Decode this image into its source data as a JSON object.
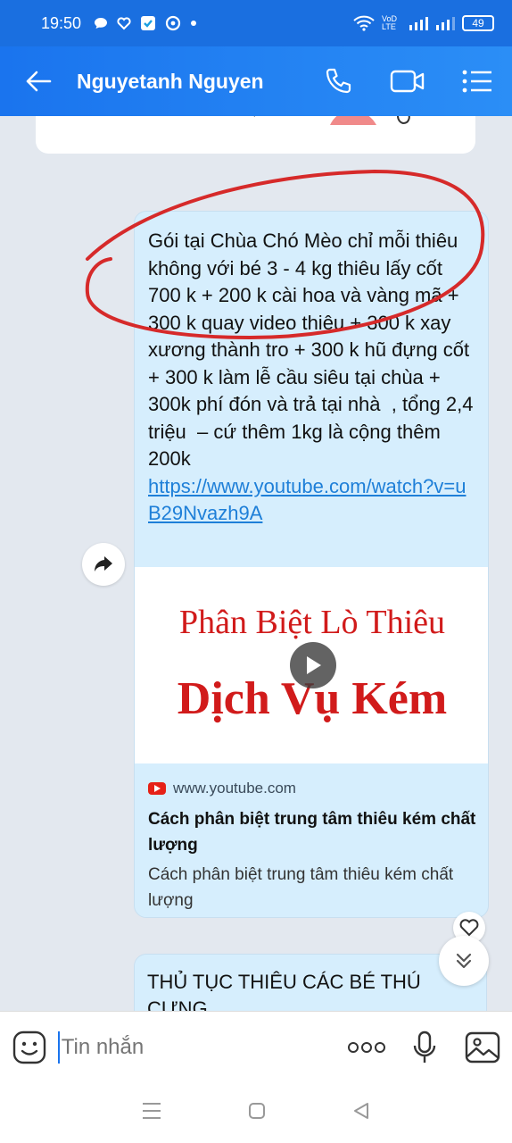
{
  "status_bar": {
    "time": "19:50",
    "net_label": "VoD LTE",
    "battery": "49"
  },
  "header": {
    "title": "Nguyetanh Nguyen"
  },
  "message": {
    "text": "Gói tại Chùa Chó Mèo chỉ mỗi thiêu không với bé 3 - 4 kg thiêu lấy cốt 700 k + 200 k cài hoa và vàng mã + 300 k quay video thiêu + 300 k xay xương thành tro + 300 k hũ đựng cốt + 300 k làm lễ cầu siêu tại chùa + 300k phí đón và trả tại nhà  , tổng 2,4 triệu  – cứ thêm 1kg là cộng thêm 200k",
    "link": "https://www.youtube.com/watch?v=uB29Nvazh9A"
  },
  "preview": {
    "thumb_line1": "Phân Biệt Lò Thiêu",
    "thumb_line2": "Dịch Vụ Kém",
    "domain": "www.youtube.com",
    "title": "Cách phân biệt trung tâm thiêu kém chất lượng",
    "description": "Cách phân biệt trung tâm thiêu kém chất lượng"
  },
  "next_message": {
    "text": "THỦ TỤC THIÊU CÁC BÉ THÚ CƯNG"
  },
  "input": {
    "placeholder": "Tin nhắn"
  },
  "colors": {
    "header": "#1a74ee",
    "bubble": "#d6eefd",
    "link": "#1e7fd8",
    "annotation": "#d62a2a"
  }
}
